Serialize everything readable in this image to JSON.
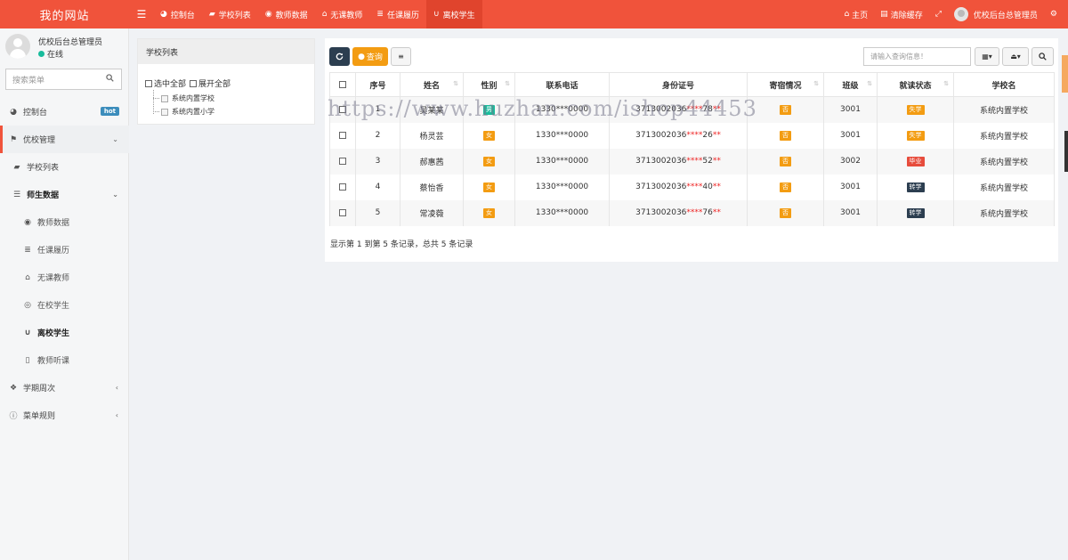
{
  "brand": "我的网站",
  "nav": [
    {
      "label": "控制台",
      "icon": "dashboard-icon"
    },
    {
      "label": "学校列表",
      "icon": "book-icon"
    },
    {
      "label": "教师数据",
      "icon": "eye-icon"
    },
    {
      "label": "无课教师",
      "icon": "home-icon"
    },
    {
      "label": "任课履历",
      "icon": "list-icon"
    },
    {
      "label": "离校学生",
      "icon": "magnet-icon",
      "active": true
    }
  ],
  "nav_right": {
    "home": "主页",
    "clear_cache": "清除缓存",
    "user": "优校后台总管理员"
  },
  "sidebar": {
    "user_name": "优校后台总管理员",
    "status": "在线",
    "search_placeholder": "搜索菜单",
    "items": [
      {
        "label": "控制台",
        "badge": "hot"
      },
      {
        "label": "优校管理"
      },
      {
        "label": "学校列表"
      },
      {
        "label": "师生数据"
      },
      {
        "label": "教师数据"
      },
      {
        "label": "任课履历"
      },
      {
        "label": "无课教师"
      },
      {
        "label": "在校学生"
      },
      {
        "label": "离校学生"
      },
      {
        "label": "教师听课"
      },
      {
        "label": "学期周次"
      },
      {
        "label": "菜单规则"
      }
    ]
  },
  "tree": {
    "title": "学校列表",
    "select_all": "选中全部",
    "expand_all": "展开全部",
    "nodes": [
      "系统内置学校",
      "系统内置小学"
    ]
  },
  "toolbar": {
    "query_label": "查询",
    "search_placeholder": "请输入查询信息！"
  },
  "table": {
    "headers": [
      "序号",
      "姓名",
      "性别",
      "联系电话",
      "身份证号",
      "寄宿情况",
      "班级",
      "就读状态",
      "学校名"
    ],
    "rows": [
      {
        "no": "1",
        "name": "吴某某",
        "gender": "男",
        "phone": "1330***0000",
        "id_prefix": "3713002036",
        "id_mask": "****",
        "id_mid": "78",
        "id_tail": "**",
        "boarding": "否",
        "class": "3001",
        "status": "失学",
        "school": "系统内置学校"
      },
      {
        "no": "2",
        "name": "杨灵芸",
        "gender": "女",
        "phone": "1330***0000",
        "id_prefix": "3713002036",
        "id_mask": "****",
        "id_mid": "26",
        "id_tail": "**",
        "boarding": "否",
        "class": "3001",
        "status": "失学",
        "school": "系统内置学校"
      },
      {
        "no": "3",
        "name": "郝惠茜",
        "gender": "女",
        "phone": "1330***0000",
        "id_prefix": "3713002036",
        "id_mask": "****",
        "id_mid": "52",
        "id_tail": "**",
        "boarding": "否",
        "class": "3002",
        "status": "毕业",
        "school": "系统内置学校"
      },
      {
        "no": "4",
        "name": "蔡怡香",
        "gender": "女",
        "phone": "1330***0000",
        "id_prefix": "3713002036",
        "id_mask": "****",
        "id_mid": "40",
        "id_tail": "**",
        "boarding": "否",
        "class": "3001",
        "status": "转学",
        "school": "系统内置学校"
      },
      {
        "no": "5",
        "name": "常凌薇",
        "gender": "女",
        "phone": "1330***0000",
        "id_prefix": "3713002036",
        "id_mask": "****",
        "id_mid": "76",
        "id_tail": "**",
        "boarding": "否",
        "class": "3001",
        "status": "转学",
        "school": "系统内置学校"
      }
    ]
  },
  "footer": "显示第 1 到第 5 条记录，总共 5 条记录",
  "watermark": "https://www.huzhan.com/ishop44453",
  "colors": {
    "topbar": "#f0533b",
    "badge_female": "#f39c12",
    "badge_male": "#18bc9c",
    "badge_boarding": "#f39c12",
    "status_dropout": "#f39c12",
    "status_graduated": "#e74c3c",
    "status_transfer": "#2c3e50",
    "refresh_button": "#2c3e50",
    "query_button": "#f39c12"
  }
}
